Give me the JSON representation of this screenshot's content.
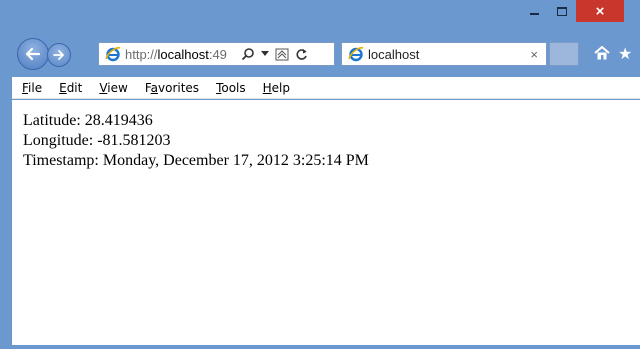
{
  "browser": {
    "address_url_prefix": "http://",
    "address_url_host": "localhost",
    "address_url_suffix": ":49",
    "tab_title": "localhost",
    "tab_close": "×",
    "close_glyph": "×"
  },
  "menu": {
    "items": [
      {
        "accel": "F",
        "rest": "ile"
      },
      {
        "accel": "E",
        "rest": "dit"
      },
      {
        "accel": "V",
        "rest": "iew"
      },
      {
        "accel": "a",
        "pre": "F",
        "rest": "vorites"
      },
      {
        "accel": "T",
        "rest": "ools"
      },
      {
        "accel": "H",
        "rest": "elp"
      }
    ]
  },
  "content": {
    "latitude": "Latitude: 28.419436",
    "longitude": "Longitude: -81.581203",
    "timestamp": "Timestamp: Monday, December 17, 2012 3:25:14 PM"
  },
  "colors": {
    "frame": "#6c98d0",
    "close_button": "#c9372c",
    "ie_icon": "#1d76d2"
  }
}
